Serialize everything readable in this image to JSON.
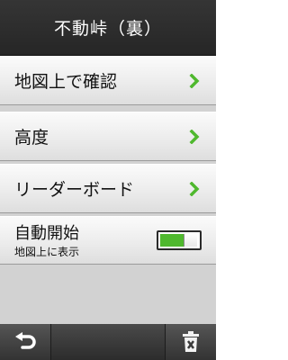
{
  "header": {
    "title": "不動峠（裏）"
  },
  "menu": {
    "items": [
      {
        "label": "地図上で確認",
        "icon": "chevron-right-icon"
      },
      {
        "label": "高度",
        "icon": "chevron-right-icon"
      },
      {
        "label": "リーダーボード",
        "icon": "chevron-right-icon"
      }
    ]
  },
  "auto_start": {
    "label": "自動開始",
    "sublabel": "地図上に表示",
    "toggle_on": true
  },
  "bottom_bar": {
    "back_icon": "back-arrow-icon",
    "delete_icon": "trash-icon"
  },
  "colors": {
    "accent_green": "#4fb82e",
    "header_bg": "#2d2d2d"
  }
}
